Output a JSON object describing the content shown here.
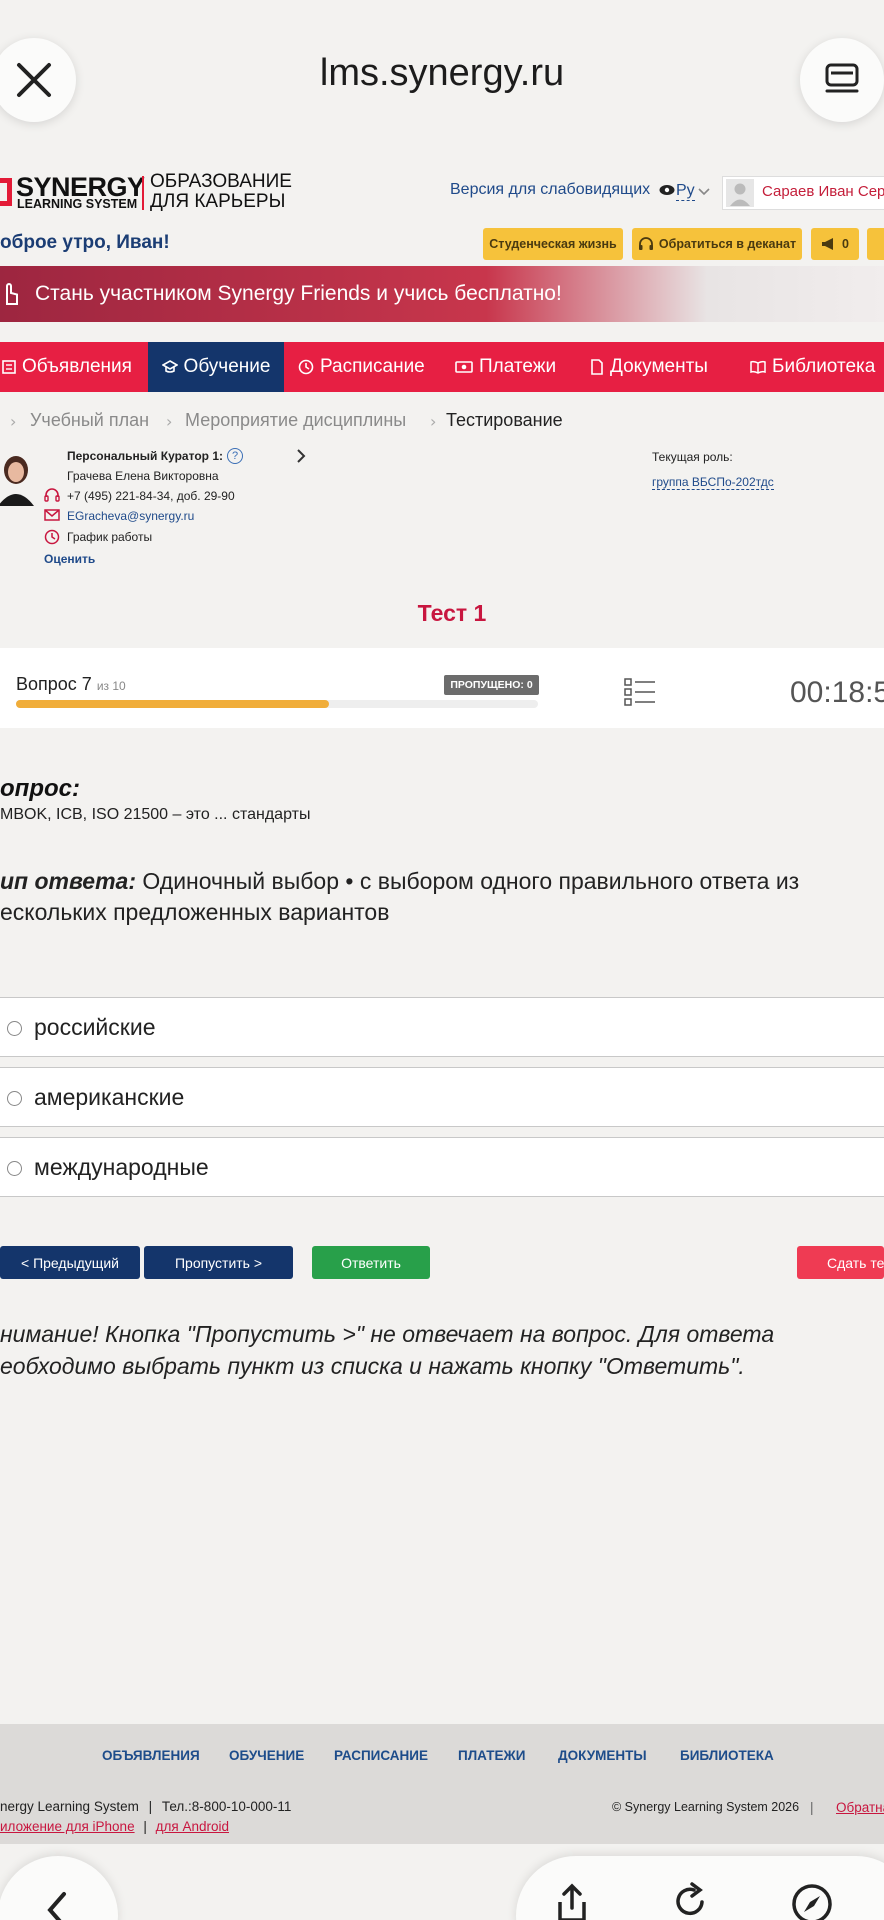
{
  "browser": {
    "url": "lms.synergy.ru"
  },
  "header": {
    "logo_main": "SYNERGY",
    "logo_sub": "LEARNING SYSTEM",
    "logo_tagline_1": "ОБРАЗОВАНИЕ",
    "logo_tagline_2": "ДЛЯ КАРЬЕРЫ",
    "vision_label": "Версия для слабовидящих",
    "lang": "Ру",
    "user_name": "Сараев Иван Серге",
    "greeting": "оброе утро, Иван!",
    "student_life": "Студенческая жизнь",
    "contact_dean": "Обратиться в деканат",
    "notifications_count": "0"
  },
  "banner": {
    "text": "Стань участником Synergy Friends и учись бесплатно!"
  },
  "nav": {
    "announcements": "Объявления",
    "learning": "Обучение",
    "schedule": "Расписание",
    "payments": "Платежи",
    "documents": "Документы",
    "library": "Библиотека"
  },
  "breadcrumb": {
    "item1": "Учебный план",
    "item2": "Мероприятие дисциплины",
    "item3": "Тестирование"
  },
  "curator": {
    "title": "Персональный Куратор 1:",
    "name": "Грачева Елена Викторовна",
    "phone": "+7 (495) 221-84-34, доб. 29-90",
    "email": "EGracheva@synergy.ru",
    "schedule": "График работы",
    "rate": "Оценить",
    "role_label": "Текущая роль:",
    "role_value": "группа ВБСПо-202тдс"
  },
  "test": {
    "title": "Тест 1",
    "question_label": "Вопрос 7",
    "question_of": "из 10",
    "skipped": "ПРОПУЩЕНО: 0",
    "timer": "00:18:5",
    "progress": 0.6
  },
  "question": {
    "head": "опрос:",
    "text": "MBOK, ICB, ISO 21500 – это ... стандарты",
    "type_label": "ип ответа:",
    "type_text_1": "Одиночный выбор • с выбором одного правильного ответа из",
    "type_text_2": "ескольких предложенных вариантов",
    "options": [
      "российские",
      "американские",
      "международные"
    ]
  },
  "buttons": {
    "prev": "< Предыдущий",
    "skip": "Пропустить >",
    "answer": "Ответить",
    "submit": "Сдать тес"
  },
  "warning": {
    "line1": "нимание! Кнопка \"Пропустить >\" не отвечает на вопрос. Для ответа",
    "line2": "еобходимо выбрать пункт из списка и нажать кнопку \"Ответить\"."
  },
  "footer": {
    "nav": [
      "ОБЪЯВЛЕНИЯ",
      "ОБУЧЕНИЕ",
      "РАСПИСАНИЕ",
      "ПЛАТЕЖИ",
      "ДОКУМЕНТЫ",
      "БИБЛИОТЕКА"
    ],
    "brand": "nergy Learning System",
    "phone": "Тел.:8-800-10-000-11",
    "copyright": "© Synergy Learning System 2026",
    "feedback": "Обратна",
    "iphone": "иложение для iPhone",
    "android": "для Android"
  },
  "colors": {
    "accent_red": "#e71f43",
    "nav_active": "#14356b",
    "answer_green": "#28a04a",
    "progress": "#f0ad3a"
  }
}
